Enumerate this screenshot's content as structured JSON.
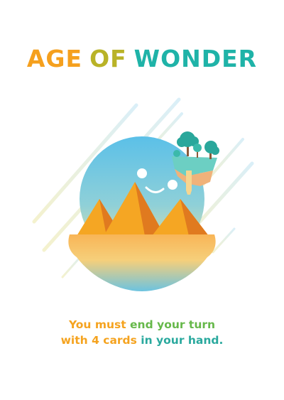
{
  "card": {
    "title_words": [
      {
        "text": "AGE",
        "color": "#f5a01e"
      },
      {
        "text": "OF",
        "color": "#b9b327"
      },
      {
        "text": "WONDER",
        "color": "#1fb3a8"
      }
    ],
    "rule_lines": [
      [
        {
          "text": "You must ",
          "color": "#f5a31f"
        },
        {
          "text": "end your turn",
          "color": "#66b84a"
        }
      ],
      [
        {
          "text": "with 4 cards",
          "color": "#f5a31f"
        },
        {
          "text": " in your hand.",
          "color": "#2aa99e"
        }
      ]
    ],
    "illustration": {
      "subject": "pyramids-under-face-moon-with-floating-island",
      "colors": {
        "sky_top": "#5bc0e8",
        "sky_bottom": "#f7e89a",
        "sand": "#f7b452",
        "pyramid_light": "#f5a623",
        "pyramid_dark": "#e07a1f",
        "trees": "#2aa79b",
        "streak": "#e6f3f8"
      }
    }
  }
}
